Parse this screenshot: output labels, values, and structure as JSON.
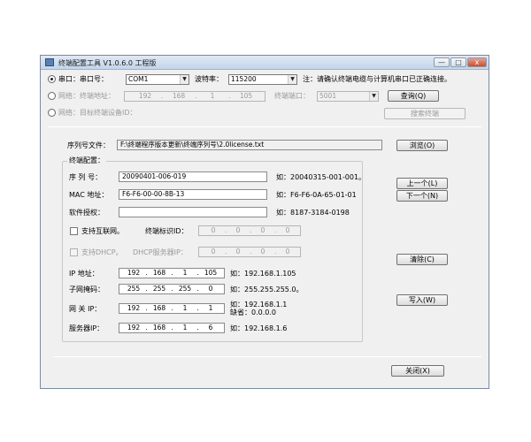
{
  "window": {
    "title": "终端配置工具 V1.0.6.0 工程版",
    "min_label": "—",
    "max_label": "□",
    "close_label": "x"
  },
  "serial": {
    "radio_label": "串口：串口号：",
    "port_value": "COM1",
    "baud_label": "波特率：",
    "baud_value": "115200",
    "note": "注：请确认终端电缆与计算机串口已正确连接。"
  },
  "network": {
    "radio_label": "网络：终端地址：",
    "ip": [
      "192",
      "168",
      "1",
      "105"
    ],
    "port_label": "终端端口：",
    "port_value": "5001",
    "query_button": "查询(Q)"
  },
  "network_target": {
    "radio_label": "网络：目标终端设备ID：",
    "search_button": "搜索终端"
  },
  "serial_file": {
    "label": "序列号文件：",
    "path": "F:\\终端程序版本更新\\终端序列号\\2.0license.txt",
    "browse_button": "浏览(O)"
  },
  "config": {
    "group_label": "终端配置：",
    "serial_no_label": "序 列 号：",
    "serial_no_value": "20090401-006-019",
    "serial_no_example": "如：20040315-001-001。",
    "mac_label": "MAC 地址：",
    "mac_value": "F6-F6-00-00-8B-13",
    "mac_example": "如：F6-F6-0A-65-01-01",
    "license_label": "软件授权：",
    "license_value": "",
    "license_example": "如：8187-3184-0198",
    "internet_label": "支持互联网。",
    "terminal_id_label": "终端标识ID：",
    "terminal_id": [
      "0",
      "0",
      "0",
      "0"
    ],
    "dhcp_label": "支持DHCP。",
    "dhcp_server_label": "DHCP服务器IP：",
    "dhcp_server_ip": [
      "0",
      "0",
      "0",
      "0"
    ],
    "ip_label": "IP  地址：",
    "ip_value": [
      "192",
      "168",
      "1",
      "105"
    ],
    "ip_example": "如：192.168.1.105",
    "mask_label": "子网掩码：",
    "mask_value": [
      "255",
      "255",
      "255",
      "0"
    ],
    "mask_example": "如：255.255.255.0。",
    "gateway_label": "网 关 IP：",
    "gateway_value": [
      "192",
      "168",
      "1",
      "1"
    ],
    "gateway_example_line1": "如：192.168.1.1",
    "gateway_example_line2": "缺省：0.0.0.0",
    "server_label": "服务器IP：",
    "server_value": [
      "192",
      "168",
      "1",
      "6"
    ],
    "server_example": "如：192.168.1.6",
    "prev_button": "上一个(L)",
    "next_button": "下一个(N)",
    "clear_button": "清除(C)",
    "write_button": "写入(W)"
  },
  "close_button": "关闭(X)"
}
